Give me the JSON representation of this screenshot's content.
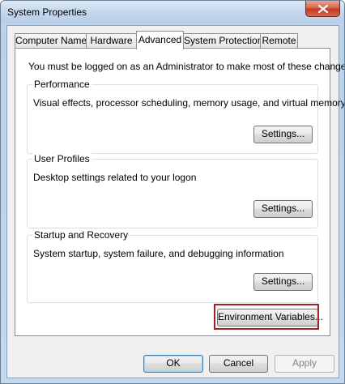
{
  "window": {
    "title": "System Properties",
    "close_label": "Close"
  },
  "tabs": [
    {
      "label": "Computer Name"
    },
    {
      "label": "Hardware"
    },
    {
      "label": "Advanced"
    },
    {
      "label": "System Protection"
    },
    {
      "label": "Remote"
    }
  ],
  "active_tab": "Advanced",
  "panel": {
    "intro": "You must be logged on as an Administrator to make most of these changes.",
    "performance": {
      "title": "Performance",
      "description": "Visual effects, processor scheduling, memory usage, and virtual memory",
      "button": "Settings..."
    },
    "user_profiles": {
      "title": "User Profiles",
      "description": "Desktop settings related to your logon",
      "button": "Settings..."
    },
    "startup_recovery": {
      "title": "Startup and Recovery",
      "description": "System startup, system failure, and debugging information",
      "button": "Settings..."
    },
    "env_button": "Environment Variables..."
  },
  "footer": {
    "ok": "OK",
    "cancel": "Cancel",
    "apply": "Apply"
  },
  "colors": {
    "highlight_border": "#a21f23",
    "close_button": "#c43a20"
  }
}
